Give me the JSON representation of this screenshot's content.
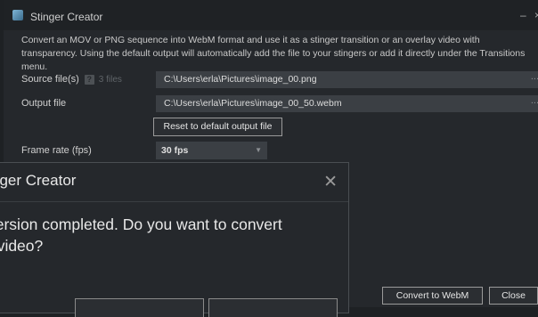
{
  "window": {
    "title": "Stinger Creator",
    "minimize_glyph": "–",
    "close_glyph": "×",
    "description": "Convert an MOV or PNG sequence into WebM format and use it as a stinger transition or an overlay video with transparency. Using the default output will automatically add the file to your stingers or add it directly under the Transitions menu."
  },
  "form": {
    "source_label": "Source file(s)",
    "help_glyph": "?",
    "source_count": "3 files",
    "source_value": "C:\\Users\\erla\\Pictures\\image_00.png",
    "output_label": "Output file",
    "output_value": "C:\\Users\\erla\\Pictures\\image_00_50.webm",
    "browse_glyph": "...",
    "reset_label": "Reset to default output file",
    "framerate_label": "Frame rate (fps)",
    "framerate_value": "30 fps",
    "dropdown_glyph": "▼"
  },
  "footer": {
    "convert_label": "Convert to WebM",
    "close_label": "Close"
  },
  "dialog": {
    "title": "nger Creator",
    "close_glyph": "✕",
    "message_line1": "version completed. Do you want to convert",
    "message_line2": "r video?"
  },
  "icons": {
    "app": "stinger-app-icon",
    "help": "help-icon",
    "browse": "ellipsis-icon",
    "dropdown": "caret-down-icon",
    "close": "close-icon"
  }
}
